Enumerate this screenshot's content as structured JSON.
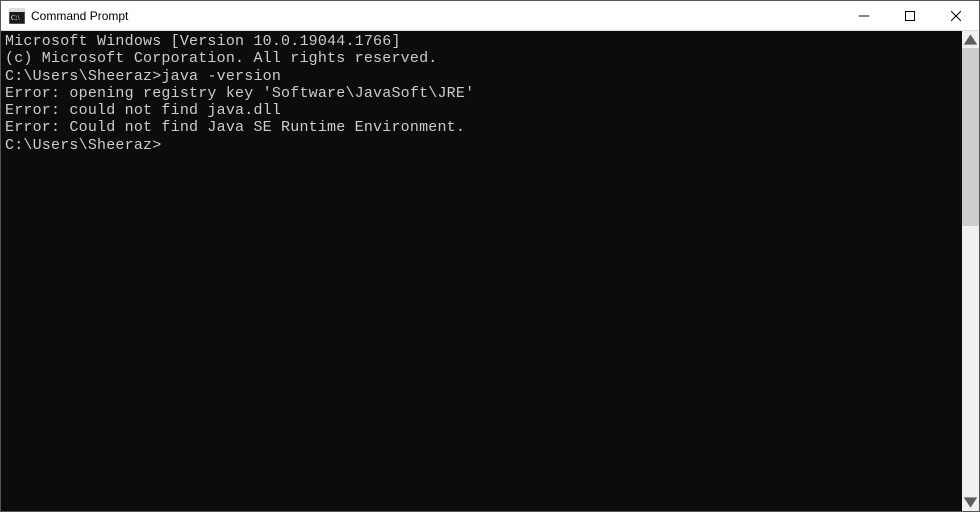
{
  "window": {
    "title": "Command Prompt"
  },
  "terminal": {
    "line1": "Microsoft Windows [Version 10.0.19044.1766]",
    "line2": "(c) Microsoft Corporation. All rights reserved.",
    "blank1": "",
    "prompt1": "C:\\Users\\Sheeraz>",
    "command1": "java -version",
    "err1": "Error: opening registry key 'Software\\JavaSoft\\JRE'",
    "err2": "Error: could not find java.dll",
    "err3": "Error: Could not find Java SE Runtime Environment.",
    "blank2": "",
    "prompt2": "C:\\Users\\Sheeraz>"
  }
}
